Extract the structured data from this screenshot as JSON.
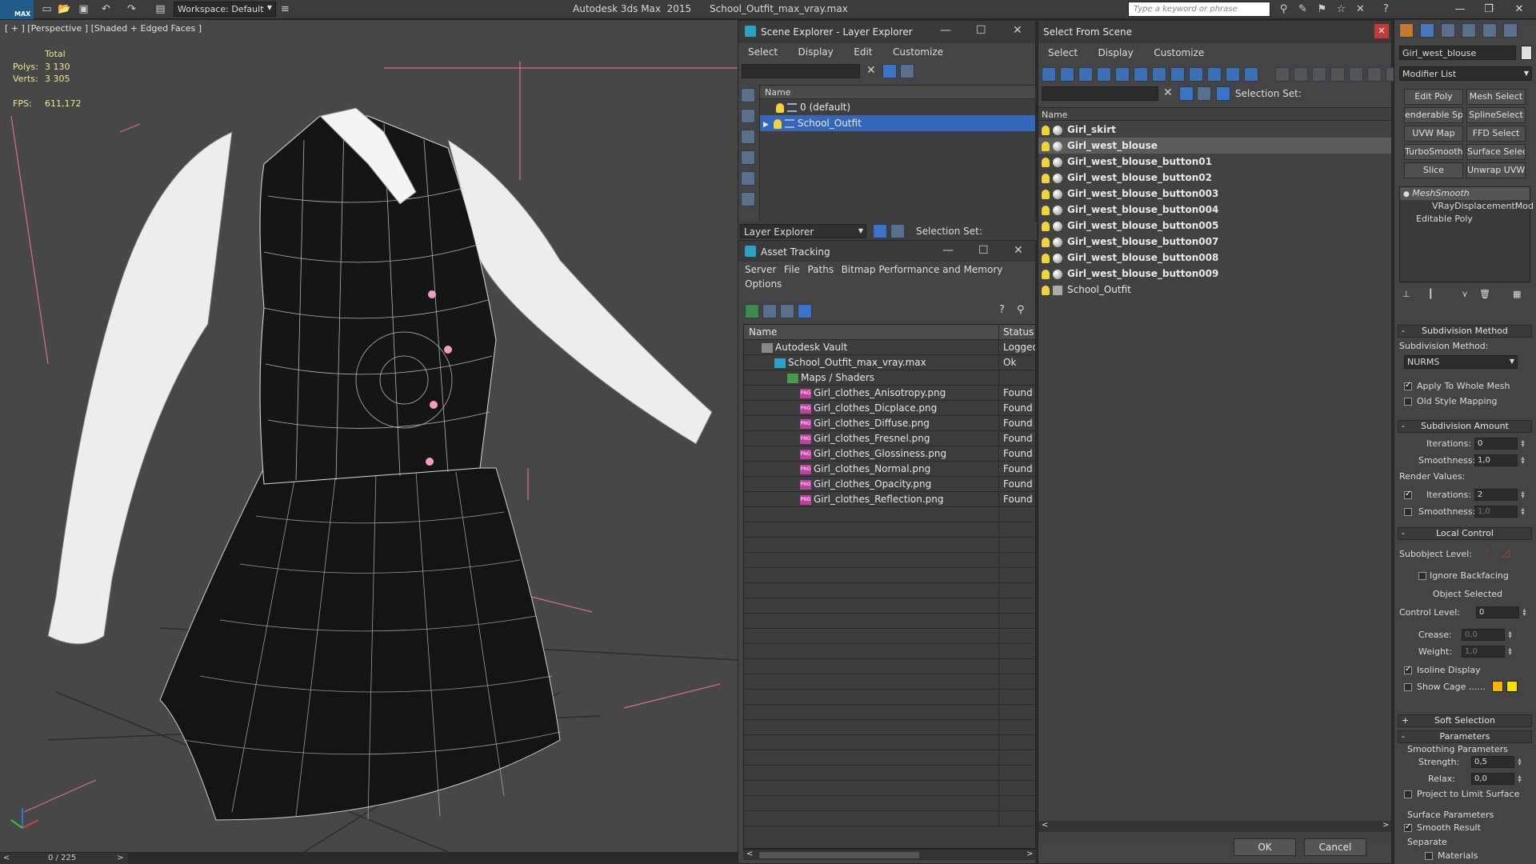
{
  "titlebar": {
    "logo": "MAX",
    "workspace": "Workspace: Default",
    "app_title": "Autodesk 3ds Max  2015      School_Outfit_max_vray.max",
    "search_placeholder": "Type a keyword or phrase"
  },
  "viewport": {
    "label": "[ + ] [Perspective ] [Shaded + Edged Faces ]",
    "stats": {
      "total_label": "Total",
      "polys_label": "Polys:",
      "polys": "3 130",
      "verts_label": "Verts:",
      "verts": "3 305",
      "fps_label": "FPS:",
      "fps": "611,172"
    },
    "timeline": "0 / 225"
  },
  "scene_explorer": {
    "title": "Scene Explorer - Layer Explorer",
    "menu": [
      "Select",
      "Display",
      "Edit",
      "Customize"
    ],
    "column": "Name",
    "layers": [
      {
        "name": "0 (default)",
        "selected": false
      },
      {
        "name": "School_Outfit",
        "selected": true
      }
    ],
    "bottom_dropdown": "Layer Explorer",
    "selection_set_label": "Selection Set:"
  },
  "asset_tracking": {
    "title": "Asset Tracking",
    "menu": [
      "Server",
      "File",
      "Paths",
      "Bitmap Performance and Memory"
    ],
    "menu2": [
      "Options"
    ],
    "columns": [
      "Name",
      "Status"
    ],
    "rows": [
      {
        "name": "Autodesk Vault",
        "status": "Logged",
        "indent": 1,
        "icon": "vault"
      },
      {
        "name": "School_Outfit_max_vray.max",
        "status": "Ok",
        "indent": 2,
        "icon": "max"
      },
      {
        "name": "Maps / Shaders",
        "status": "",
        "indent": 3,
        "icon": "folder"
      },
      {
        "name": "Girl_clothes_Anisotropy.png",
        "status": "Found",
        "indent": 4,
        "icon": "png"
      },
      {
        "name": "Girl_clothes_Dicplace.png",
        "status": "Found",
        "indent": 4,
        "icon": "png"
      },
      {
        "name": "Girl_clothes_Diffuse.png",
        "status": "Found",
        "indent": 4,
        "icon": "png"
      },
      {
        "name": "Girl_clothes_Fresnel.png",
        "status": "Found",
        "indent": 4,
        "icon": "png"
      },
      {
        "name": "Girl_clothes_Glossiness.png",
        "status": "Found",
        "indent": 4,
        "icon": "png"
      },
      {
        "name": "Girl_clothes_Normal.png",
        "status": "Found",
        "indent": 4,
        "icon": "png"
      },
      {
        "name": "Girl_clothes_Opacity.png",
        "status": "Found",
        "indent": 4,
        "icon": "png"
      },
      {
        "name": "Girl_clothes_Reflection.png",
        "status": "Found",
        "indent": 4,
        "icon": "png"
      }
    ]
  },
  "select_from_scene": {
    "title": "Select From Scene",
    "menu": [
      "Select",
      "Display",
      "Customize"
    ],
    "selection_set_label": "Selection Set:",
    "column": "Name",
    "items": [
      {
        "name": "Girl_skirt",
        "selected": false,
        "bold": true
      },
      {
        "name": "Girl_west_blouse",
        "selected": true,
        "bold": true
      },
      {
        "name": "Girl_west_blouse_button01",
        "selected": false,
        "bold": true
      },
      {
        "name": "Girl_west_blouse_button02",
        "selected": false,
        "bold": true
      },
      {
        "name": "Girl_west_blouse_button003",
        "selected": false,
        "bold": true
      },
      {
        "name": "Girl_west_blouse_button004",
        "selected": false,
        "bold": true
      },
      {
        "name": "Girl_west_blouse_button005",
        "selected": false,
        "bold": true
      },
      {
        "name": "Girl_west_blouse_button007",
        "selected": false,
        "bold": true
      },
      {
        "name": "Girl_west_blouse_button008",
        "selected": false,
        "bold": true
      },
      {
        "name": "Girl_west_blouse_button009",
        "selected": false,
        "bold": true
      },
      {
        "name": "School_Outfit",
        "selected": false,
        "bold": false
      }
    ],
    "ok": "OK",
    "cancel": "Cancel"
  },
  "command_panel": {
    "object_name": "Girl_west_blouse",
    "modifier_list": "Modifier List",
    "modifier_buttons": [
      "Edit Poly",
      "Mesh Select",
      "enderable Splin",
      "SplineSelect",
      "UVW Map",
      "FFD Select",
      "TurboSmooth",
      "Surface Select",
      "Slice",
      "Unwrap UVW"
    ],
    "stack": [
      "MeshSmooth",
      "VRayDisplacementMod",
      "Editable Poly"
    ],
    "subdivision_method": {
      "title": "Subdivision Method",
      "label": "Subdivision Method:",
      "value": "NURMS",
      "apply_whole_mesh": "Apply To Whole Mesh",
      "old_style_mapping": "Old Style Mapping"
    },
    "subdivision_amount": {
      "title": "Subdivision Amount",
      "iterations_label": "Iterations:",
      "iterations": "0",
      "smoothness_label": "Smoothness:",
      "smoothness": "1,0",
      "render_values": "Render Values:",
      "r_iterations_label": "Iterations:",
      "r_iterations": "2",
      "r_smoothness_label": "Smoothness:",
      "r_smoothness": "1,0"
    },
    "local_control": {
      "title": "Local Control",
      "subobject_label": "Subobject Level:",
      "ignore_backfacing": "Ignore Backfacing",
      "object_selected": "Object Selected",
      "control_level_label": "Control Level:",
      "control_level": "0",
      "crease_label": "Crease:",
      "crease": "0,0",
      "weight_label": "Weight:",
      "weight": "1,0",
      "isoline": "Isoline Display",
      "show_cage": "Show Cage ......"
    },
    "soft_selection": "Soft Selection",
    "parameters": {
      "title": "Parameters",
      "smoothing": "Smoothing Parameters",
      "strength_label": "Strength:",
      "strength": "0,5",
      "relax_label": "Relax:",
      "relax": "0,0",
      "project": "Project to Limit Surface",
      "surface": "Surface Parameters",
      "smooth_result": "Smooth Result",
      "separate": "Separate",
      "materials": "Materials"
    }
  },
  "colors": {
    "selection_blue": "#3467b8",
    "bulb_yellow": "#f2d33b",
    "stats_yellow": "#f0e68c",
    "cage_orange": "#f5b400"
  }
}
